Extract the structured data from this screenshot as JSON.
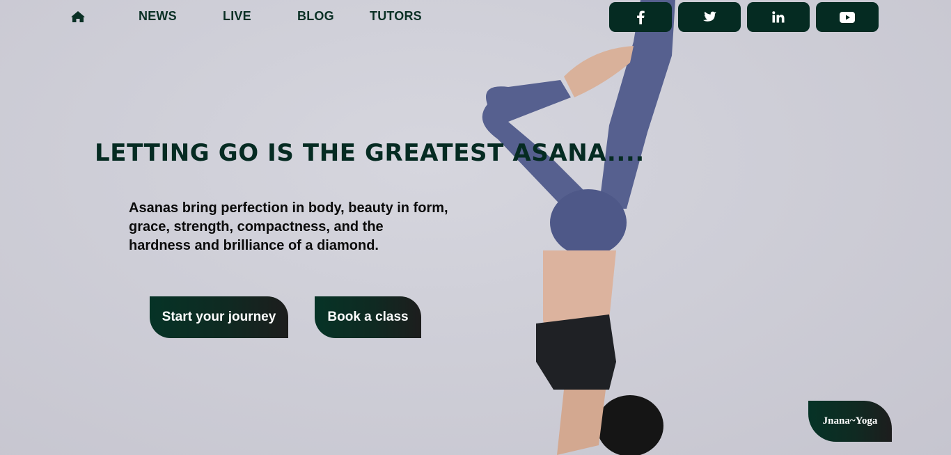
{
  "nav": {
    "home_icon": "home-icon",
    "links": [
      "NEWS",
      "LIVE",
      "BLOG",
      "TUTORS"
    ]
  },
  "social": {
    "icons": [
      "facebook-icon",
      "twitter-icon",
      "linkedin-icon",
      "youtube-icon"
    ]
  },
  "hero": {
    "headline": "LETTING GO IS THE GREATEST ASANA....",
    "subtext": "Asanas bring perfection in body, beauty in form, grace, strength, compactness, and the hardness and brilliance of a diamond.",
    "start_label": "Start your journey",
    "book_label": "Book a class"
  },
  "brand": {
    "name": "Jnana~Yoga"
  },
  "colors": {
    "accent": "#052b22",
    "background": "#cfcfd8",
    "leggings": "#56608f"
  }
}
